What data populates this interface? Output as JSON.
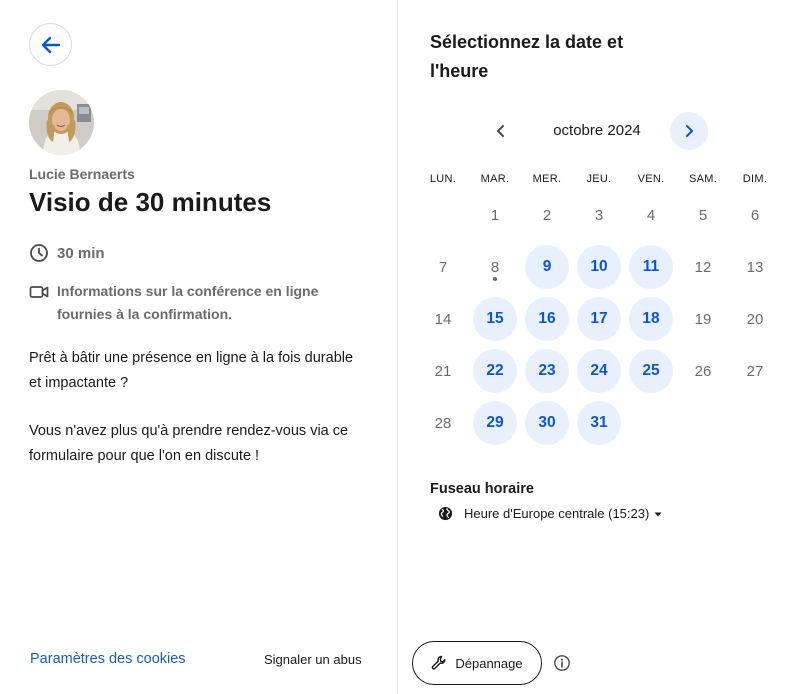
{
  "event": {
    "host_name": "Lucie Bernaerts",
    "title": "Visio de 30 minutes",
    "duration": "30 min",
    "conference_info": "Informations sur la conférence en ligne fournies à la confirmation.",
    "description_p1": "Prêt à bâtir une présence en ligne à la fois durable et impactante ?",
    "description_p2": "Vous n'avez plus qu'à prendre rendez-vous via ce formulaire pour que l'on en discute !"
  },
  "footer": {
    "cookie_settings": "Paramètres des cookies",
    "report_abuse": "Signaler un abus"
  },
  "calendar": {
    "heading": "Sélectionnez la date et l'heure",
    "month_label": "octobre 2024",
    "weekdays": [
      "LUN.",
      "MAR.",
      "MER.",
      "JEU.",
      "VEN.",
      "SAM.",
      "DIM."
    ],
    "weeks": [
      [
        null,
        "1",
        "2",
        "3",
        "4",
        "5",
        "6"
      ],
      [
        "7",
        "8",
        "9",
        "10",
        "11",
        "12",
        "13"
      ],
      [
        "14",
        "15",
        "16",
        "17",
        "18",
        "19",
        "20"
      ],
      [
        "21",
        "22",
        "23",
        "24",
        "25",
        "26",
        "27"
      ],
      [
        "28",
        "29",
        "30",
        "31",
        null,
        null,
        null
      ]
    ],
    "available_days": [
      "9",
      "10",
      "11",
      "15",
      "16",
      "17",
      "18",
      "22",
      "23",
      "24",
      "25",
      "29",
      "30",
      "31"
    ],
    "today": "8"
  },
  "timezone": {
    "title": "Fuseau horaire",
    "value": "Heure d'Europe centrale (15:23)"
  },
  "actions": {
    "troubleshoot": "Dépannage"
  },
  "colors": {
    "accent": "#0b57d0",
    "available_bg": "#e8f0fd",
    "link": "#1a5fb4",
    "muted": "#6b6b6b"
  }
}
